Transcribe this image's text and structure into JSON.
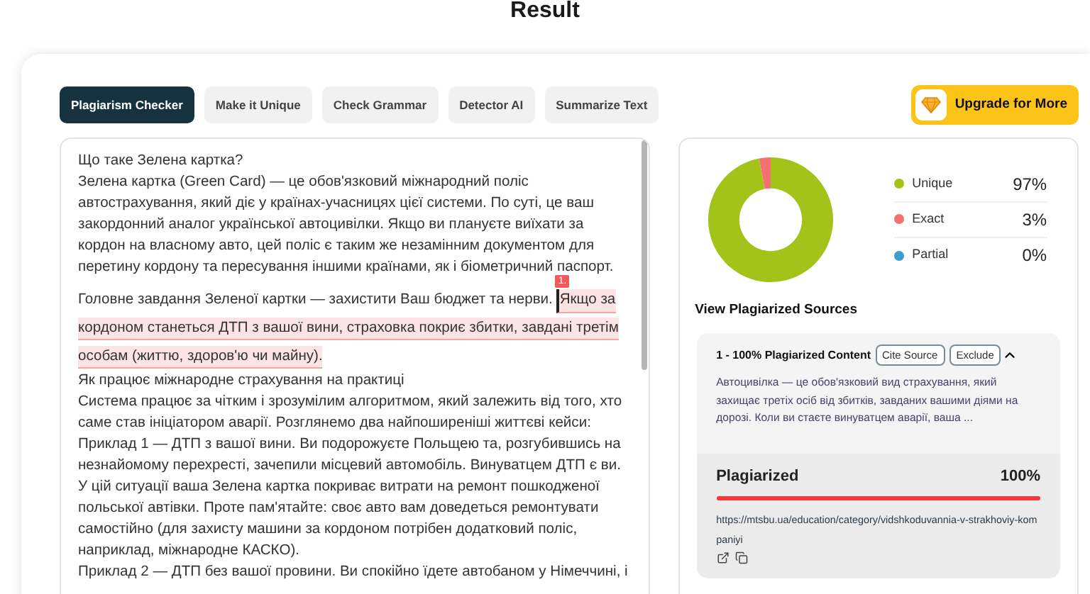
{
  "page_title": "Result",
  "tabs": [
    {
      "label": "Plagiarism Checker",
      "selected": true
    },
    {
      "label": "Make it Unique",
      "selected": false
    },
    {
      "label": "Check Grammar",
      "selected": false
    },
    {
      "label": "Detector AI",
      "selected": false
    },
    {
      "label": "Summarize Text",
      "selected": false
    }
  ],
  "upgrade_button": {
    "label": "Upgrade for More"
  },
  "text": {
    "paragraphs": [
      {
        "text": "Що таке Зелена картка?"
      },
      {
        "text": "Зелена картка (Green Card) — це обов'язковий міжнародний поліс автострахування, який діє у країнах-учасницях цієї системи. По суті, це ваш закордонний аналог української автоцивілки. Якщо ви плануєте виїхати за кордон на власному авто, цей поліс є таким же незамінним документом для перетину кордону та пересування іншими країнами, як і біометричний паспорт."
      },
      {
        "text": "Головне завдання Зеленої картки — захистити Ваш бюджет та нерви.",
        "match": {
          "marker": "1.",
          "lines": [
            "Якщо за",
            "кордоном станеться ДТП з вашої вини, страховка покриє збитки, завдані третім",
            "особам (життю, здоров'ю чи майну)."
          ]
        }
      },
      {
        "text": "Як працює міжнародне страхування на практиці"
      },
      {
        "text": "Система працює за чітким і зрозумілим алгоритмом, який залежить від того, хто саме став ініціатором аварії. Розглянемо два найпоширеніші життєві кейси:"
      },
      {
        "text": "Приклад 1 — ДТП з вашої вини. Ви подорожуєте Польщею та, розгубившись на незнайомому перехресті, зачепили місцевий автомобіль. Винуватцем ДТП є ви. У цій ситуації ваша Зелена картка покриває витрати на ремонт пошкодженої польської автівки. Проте пам'ятайте: своє авто вам доведеться ремонтувати самостійно (для захисту машини за кордоном потрібен додатковий поліс, наприклад, міжнародне КАСКО)."
      },
      {
        "text": "Приклад 2 — ДТП без вашої провини. Ви спокійно їдете автобаном у Німеччині, і"
      }
    ]
  },
  "results": {
    "chart_data": {
      "type": "donut",
      "categories": [
        "Unique",
        "Exact",
        "Partial"
      ],
      "values": [
        97,
        3,
        0
      ]
    },
    "legend": [
      {
        "value": "97%",
        "color": "#a3c31a"
      },
      {
        "value": "3%",
        "color": "#f47171"
      },
      {
        "value": "0%",
        "color": "#3a9fc9"
      }
    ],
    "sources_title": "View Plagiarized Sources",
    "sources": [
      {
        "title": "1 - 100% Plagiarized Content",
        "expanded": true,
        "cite_button": "Cite Source",
        "exclude_button": "Exclude",
        "snippet": "Автоцивілка — це обов'язковий вид страхування, який захищає третіх осіб від збитків, завданих вашими діями на дорозі. Коли ви стаєте винуватцем аварії, ваша ...",
        "label": "Plagiarized",
        "percent": "100%",
        "level": 1,
        "url": "https://mtsbu.ua/education/category/vidshkoduvannia-v-strakhoviy-kompaniyi"
      }
    ]
  }
}
